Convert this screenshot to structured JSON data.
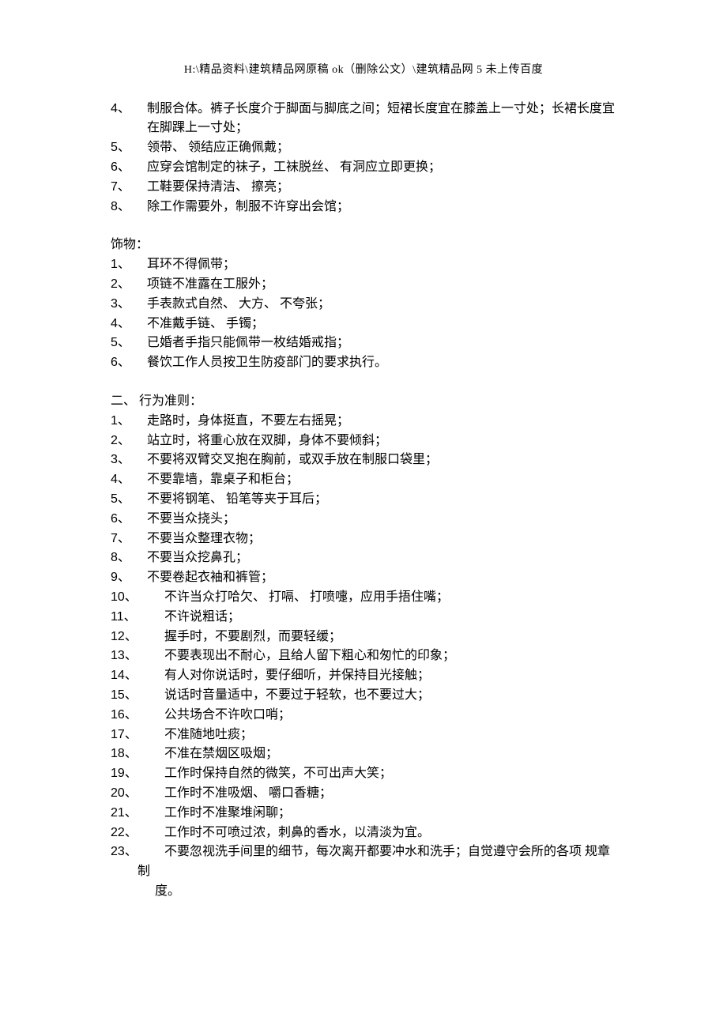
{
  "header_path": "H:\\精品资料\\建筑精品网原稿 ok（删除公文）\\建筑精品网 5 未上传百度",
  "sectionA": {
    "items": [
      {
        "n": "4、",
        "t": "制服合体。裤子长度介于脚面与脚底之间；短裙长度宜在膝盖上一寸处；长裙长度宜",
        "t2": "在脚踝上一寸处；"
      },
      {
        "n": "5、",
        "t": "领带、 领结应正确佩戴；"
      },
      {
        "n": "6、",
        "t": "应穿会馆制定的袜子，工袜脱丝、 有洞应立即更换；"
      },
      {
        "n": "7、",
        "t": "工鞋要保持清洁、 擦亮；"
      },
      {
        "n": "8、",
        "t": "除工作需要外，制服不许穿出会馆；"
      }
    ]
  },
  "sectionB": {
    "title": "饰物：",
    "items": [
      {
        "n": "1、",
        "t": "耳环不得佩带；"
      },
      {
        "n": "2、",
        "t": "项链不准露在工服外；"
      },
      {
        "n": "3、",
        "t": "手表款式自然、 大方、 不夸张；"
      },
      {
        "n": "4、",
        "t": "不准戴手链、 手镯；"
      },
      {
        "n": "5、",
        "t": "已婚者手指只能佩带一枚结婚戒指；"
      },
      {
        "n": "6、",
        "t": "餐饮工作人员按卫生防疫部门的要求执行。"
      }
    ]
  },
  "sectionC": {
    "title": "二、 行为准则：",
    "items": [
      {
        "n": "1、",
        "t": "走路时，身体挺直，不要左右摇晃；"
      },
      {
        "n": "2、",
        "t": "站立时，将重心放在双脚，身体不要倾斜；"
      },
      {
        "n": "3、",
        "t": "不要将双臂交叉抱在胸前，或双手放在制服口袋里；"
      },
      {
        "n": "4、",
        "t": "不要靠墙，靠桌子和柜台；"
      },
      {
        "n": "5、",
        "t": "不要将钢笔、 铅笔等夹于耳后；"
      },
      {
        "n": "6、",
        "t": "不要当众挠头；"
      },
      {
        "n": "7、",
        "t": "不要当众整理衣物；"
      },
      {
        "n": "8、",
        "t": "不要当众挖鼻孔；"
      },
      {
        "n": "9、",
        "t": "不要卷起衣袖和裤管；"
      },
      {
        "n": "10、",
        "t": "不许当众打哈欠、 打嗝、 打喷嚏，应用手捂住嘴；"
      },
      {
        "n": "11、",
        "t": "不许说粗话；"
      },
      {
        "n": "12、",
        "t": "握手时，不要剧烈，而要轻缓；"
      },
      {
        "n": "13、",
        "t": "不要表现出不耐心，且给人留下粗心和匆忙的印象；"
      },
      {
        "n": "14、",
        "t": "有人对你说话时，要仔细听，并保持目光接触；"
      },
      {
        "n": "15、",
        "t": "说话时音量适中，不要过于轻软，也不要过大；"
      },
      {
        "n": "16、",
        "t": "公共场合不许吹口哨；"
      },
      {
        "n": "17、",
        "t": "不准随地吐痰；"
      },
      {
        "n": "18、",
        "t": "不准在禁烟区吸烟；"
      },
      {
        "n": "19、",
        "t": "工作时保持自然的微笑，不可出声大笑；"
      },
      {
        "n": "20、",
        "t": "工作时不准吸烟、 嚼口香糖；"
      },
      {
        "n": "21、",
        "t": "工作时不准聚堆闲聊；"
      },
      {
        "n": "22、",
        "t": "工作时不可喷过浓，刺鼻的香水，以清淡为宜。"
      },
      {
        "n": "23、",
        "t": "不要忽视洗手间里的细节，每次离开都要冲水和洗手；自觉遵守会所的各项 规章",
        "t2a": "制",
        "t2b": "度。"
      }
    ]
  }
}
